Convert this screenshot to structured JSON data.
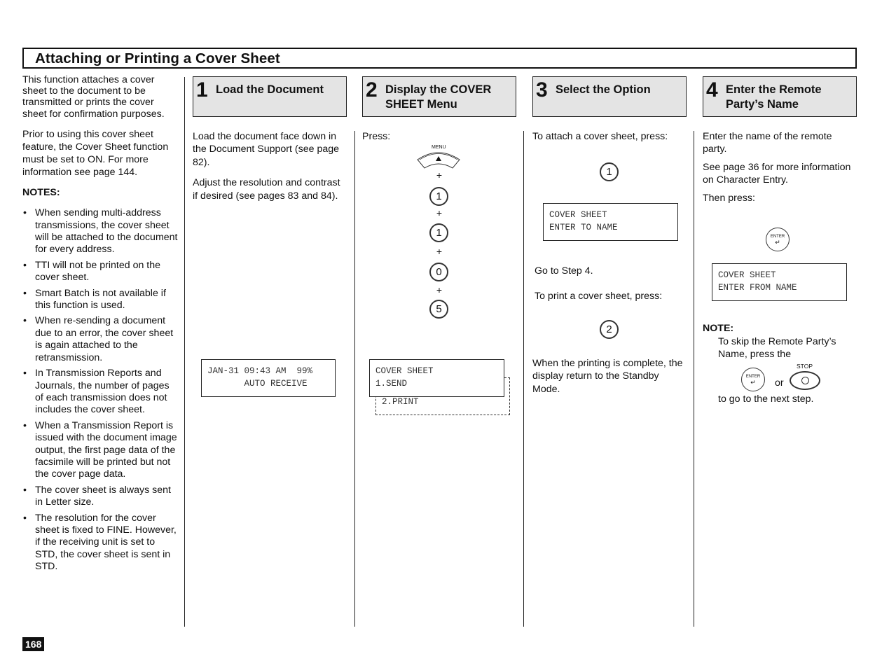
{
  "page": {
    "title": "Attaching or Printing a Cover Sheet",
    "page_number": "168"
  },
  "intro": {
    "paragraphs": [
      "This function attaches a cover sheet to the document to be transmitted or prints the cover sheet for confirmation purposes.",
      "Prior to using this cover sheet feature, the Cover Sheet function must be set to ON. For more information see  page 144."
    ],
    "notes_heading": "NOTES:",
    "notes": [
      "When sending multi-address transmissions, the cover sheet will be attached to the document for every address.",
      "TTI will not be printed on the cover sheet.",
      "Smart Batch is not available if this function is used.",
      "When re-sending a document due to an error, the cover sheet is again attached to the retransmission.",
      "In Transmission Reports and Journals, the number of pages of each transmission does not includes the cover sheet.",
      "When a Transmission Report is issued with the document image output, the first page data of the facsimile will be printed but not the cover page data.",
      "The cover sheet is always sent in Letter size.",
      "The resolution for the cover sheet is fixed to FINE. However, if the receiving unit is set to STD, the cover sheet is sent in STD."
    ]
  },
  "steps": [
    {
      "number": "1",
      "title": "Load the Document",
      "paragraphs": [
        "Load the document face down in the Document Support (see page 82).",
        "Adjust the resolution and contrast if desired (see pages 83 and 84)."
      ],
      "lcd": [
        "JAN-31 09:43 AM  99%",
        "       AUTO RECEIVE"
      ]
    },
    {
      "number": "2",
      "title": "Display the COVER SHEET Menu",
      "press_label": "Press:",
      "menu_key_label": "MENU",
      "menu_key_icon": "up-arrow-icon",
      "plus": "+",
      "keys": [
        "1",
        "1",
        "0",
        "5"
      ],
      "lcd": [
        "COVER SHEET",
        "1.SEND"
      ],
      "lcd_hidden_line": "2.PRINT"
    },
    {
      "number": "3",
      "title": "Select the Option",
      "attach_text": "To attach a cover sheet, press:",
      "attach_key": "1",
      "lcd": [
        "COVER SHEET",
        "ENTER TO NAME"
      ],
      "goto_text": "Go to Step 4.",
      "print_text": "To print a cover sheet, press:",
      "print_key": "2",
      "complete_text": "When the printing is complete, the display return to the Standby Mode."
    },
    {
      "number": "4",
      "title": "Enter the Remote Party’s Name",
      "paragraphs": [
        "Enter the name of the remote party.",
        "See page 36 for more information on Character Entry.",
        "Then press:"
      ],
      "enter_key_label": "ENTER",
      "lcd": [
        "COVER SHEET",
        "ENTER FROM NAME"
      ],
      "note_heading": "NOTE:",
      "note_text": "To skip the Remote Party’s Name, press the",
      "or_text": "or",
      "stop_key_label": "STOP",
      "note_tail": "to go to the next step."
    }
  ]
}
